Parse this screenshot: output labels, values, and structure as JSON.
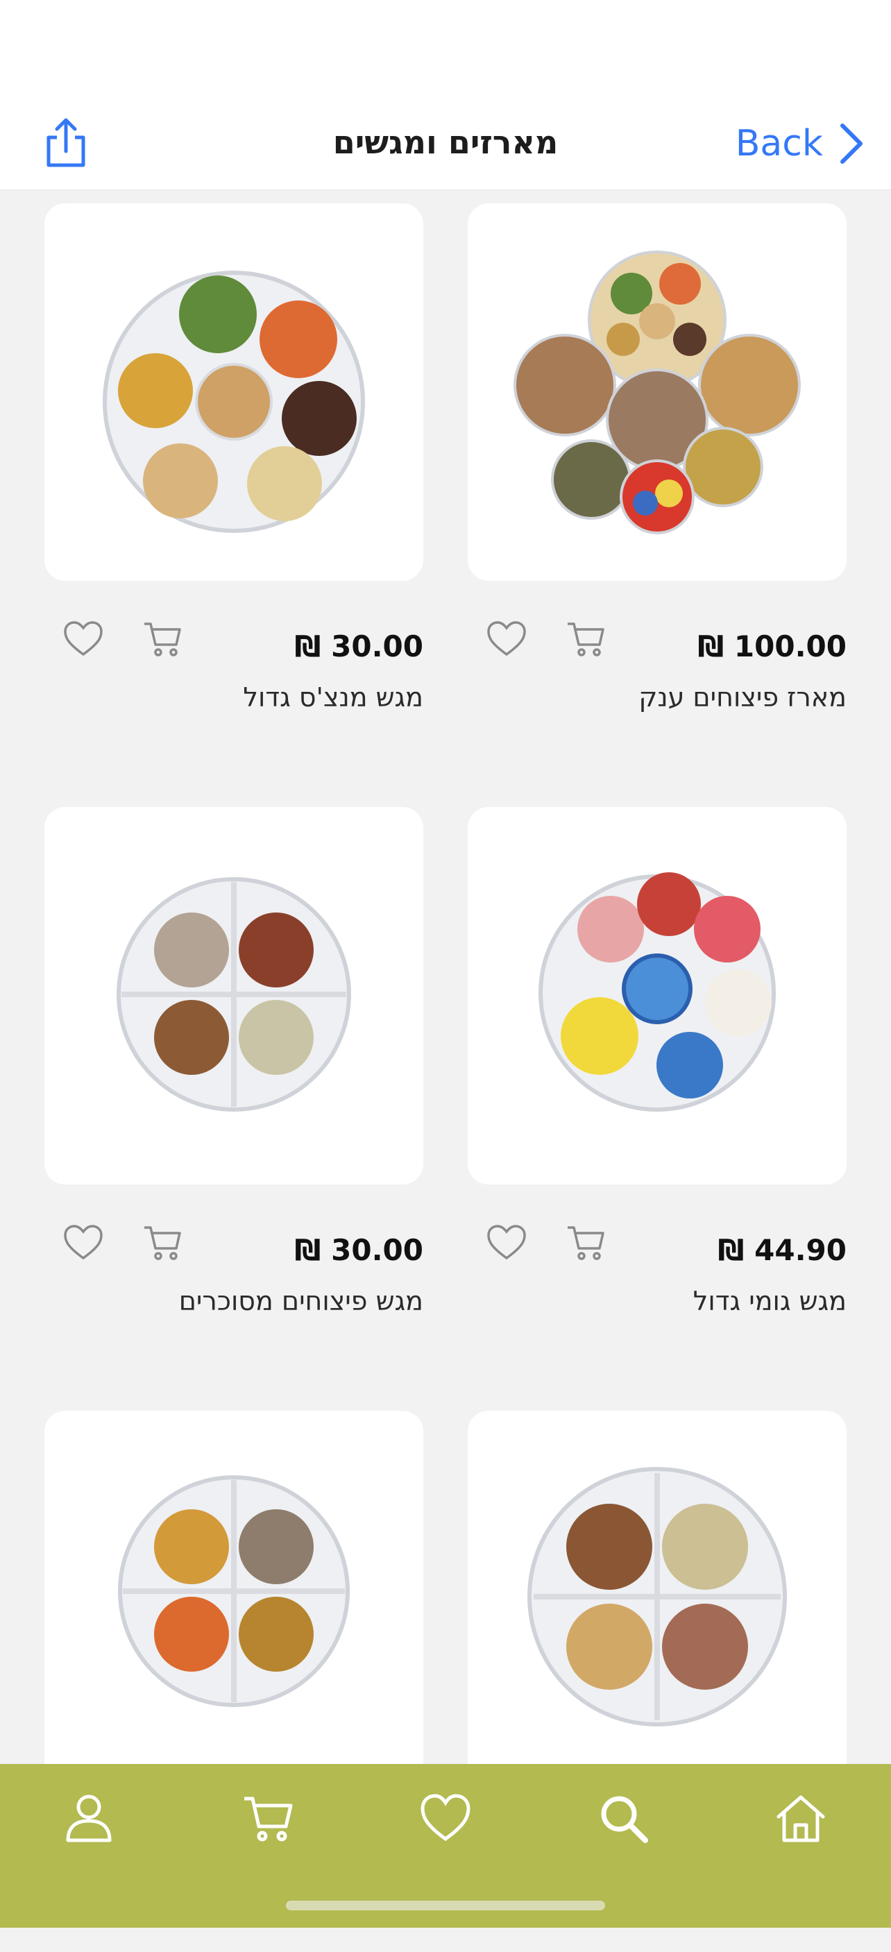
{
  "header": {
    "title": "מארזים ומגשים",
    "back_label": "Back",
    "share_icon": "share-icon"
  },
  "products": [
    {
      "name": "מארז פיצוחים ענק",
      "price": "₪ 100.00"
    },
    {
      "name": "מגש מנצ'ס גדול",
      "price": "₪ 30.00"
    },
    {
      "name": "מגש גומי גדול",
      "price": "₪ 44.90"
    },
    {
      "name": "מגש פיצוחים מסוכרים",
      "price": "₪ 30.00"
    },
    {
      "name": "",
      "price": ""
    },
    {
      "name": "",
      "price": ""
    }
  ],
  "tabbar": {
    "items": [
      "profile-icon",
      "cart-icon",
      "heart-icon",
      "search-icon",
      "home-icon"
    ],
    "color": "#b2ba50"
  },
  "colors": {
    "accent": "#3478f6",
    "background": "#f2f2f2"
  }
}
